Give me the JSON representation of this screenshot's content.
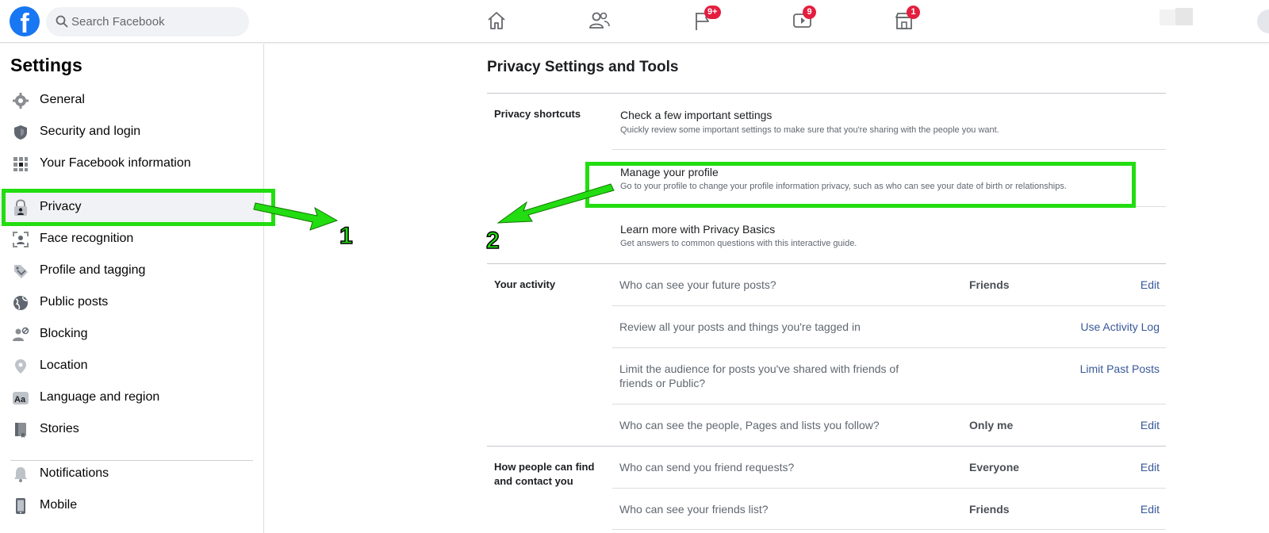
{
  "topbar": {
    "logo": "f",
    "search_placeholder": "Search Facebook",
    "nav": [
      {
        "name": "home-icon",
        "badge": ""
      },
      {
        "name": "friends-icon",
        "badge": ""
      },
      {
        "name": "pages-flag-icon",
        "badge": "9+"
      },
      {
        "name": "watch-icon",
        "badge": "9"
      },
      {
        "name": "marketplace-icon",
        "badge": "1"
      }
    ]
  },
  "sidebar": {
    "title": "Settings",
    "items": [
      {
        "label": "General",
        "icon": "gear-icon"
      },
      {
        "label": "Security and login",
        "icon": "shield-icon"
      },
      {
        "label": "Your Facebook information",
        "icon": "grid-info-icon"
      },
      {
        "label": "Privacy",
        "icon": "lock-person-icon"
      },
      {
        "label": "Face recognition",
        "icon": "face-recognition-icon"
      },
      {
        "label": "Profile and tagging",
        "icon": "tag-icon"
      },
      {
        "label": "Public posts",
        "icon": "globe-icon"
      },
      {
        "label": "Blocking",
        "icon": "blocking-icon"
      },
      {
        "label": "Location",
        "icon": "location-pin-icon"
      },
      {
        "label": "Language and region",
        "icon": "language-icon"
      },
      {
        "label": "Stories",
        "icon": "book-icon"
      },
      {
        "label": "Notifications",
        "icon": "bell-icon"
      },
      {
        "label": "Mobile",
        "icon": "phone-icon"
      }
    ],
    "active_item": "Privacy"
  },
  "main": {
    "title": "Privacy Settings and Tools",
    "sections": {
      "shortcuts": {
        "label": "Privacy shortcuts",
        "items": [
          {
            "title": "Check a few important settings",
            "desc": "Quickly review some important settings to make sure that you're sharing with the people you want."
          },
          {
            "title": "Manage your profile",
            "desc": "Go to your profile to change your profile information privacy, such as who can see your date of birth or relationships."
          },
          {
            "title": "Learn more with Privacy Basics",
            "desc": "Get answers to common questions with this interactive guide."
          }
        ]
      },
      "activity": {
        "label": "Your activity",
        "rows": [
          {
            "question": "Who can see your future posts?",
            "value": "Friends",
            "action": "Edit"
          },
          {
            "question": "Review all your posts and things you're tagged in",
            "value": "",
            "action": "Use Activity Log"
          },
          {
            "question": "Limit the audience for posts you've shared with friends of friends or Public?",
            "value": "",
            "action": "Limit Past Posts"
          },
          {
            "question": "Who can see the people, Pages and lists you follow?",
            "value": "Only me",
            "action": "Edit"
          }
        ]
      },
      "find": {
        "label": "How people can find and contact you",
        "rows": [
          {
            "question": "Who can send you friend requests?",
            "value": "Everyone",
            "action": "Edit"
          },
          {
            "question": "Who can see your friends list?",
            "value": "Friends",
            "action": "Edit"
          }
        ]
      }
    }
  },
  "annotations": {
    "step1": "1",
    "step2": "2",
    "highlight_color": "#22dd11"
  },
  "colors": {
    "brand": "#1877f2",
    "badge": "#e41e3f",
    "link": "#385898"
  }
}
